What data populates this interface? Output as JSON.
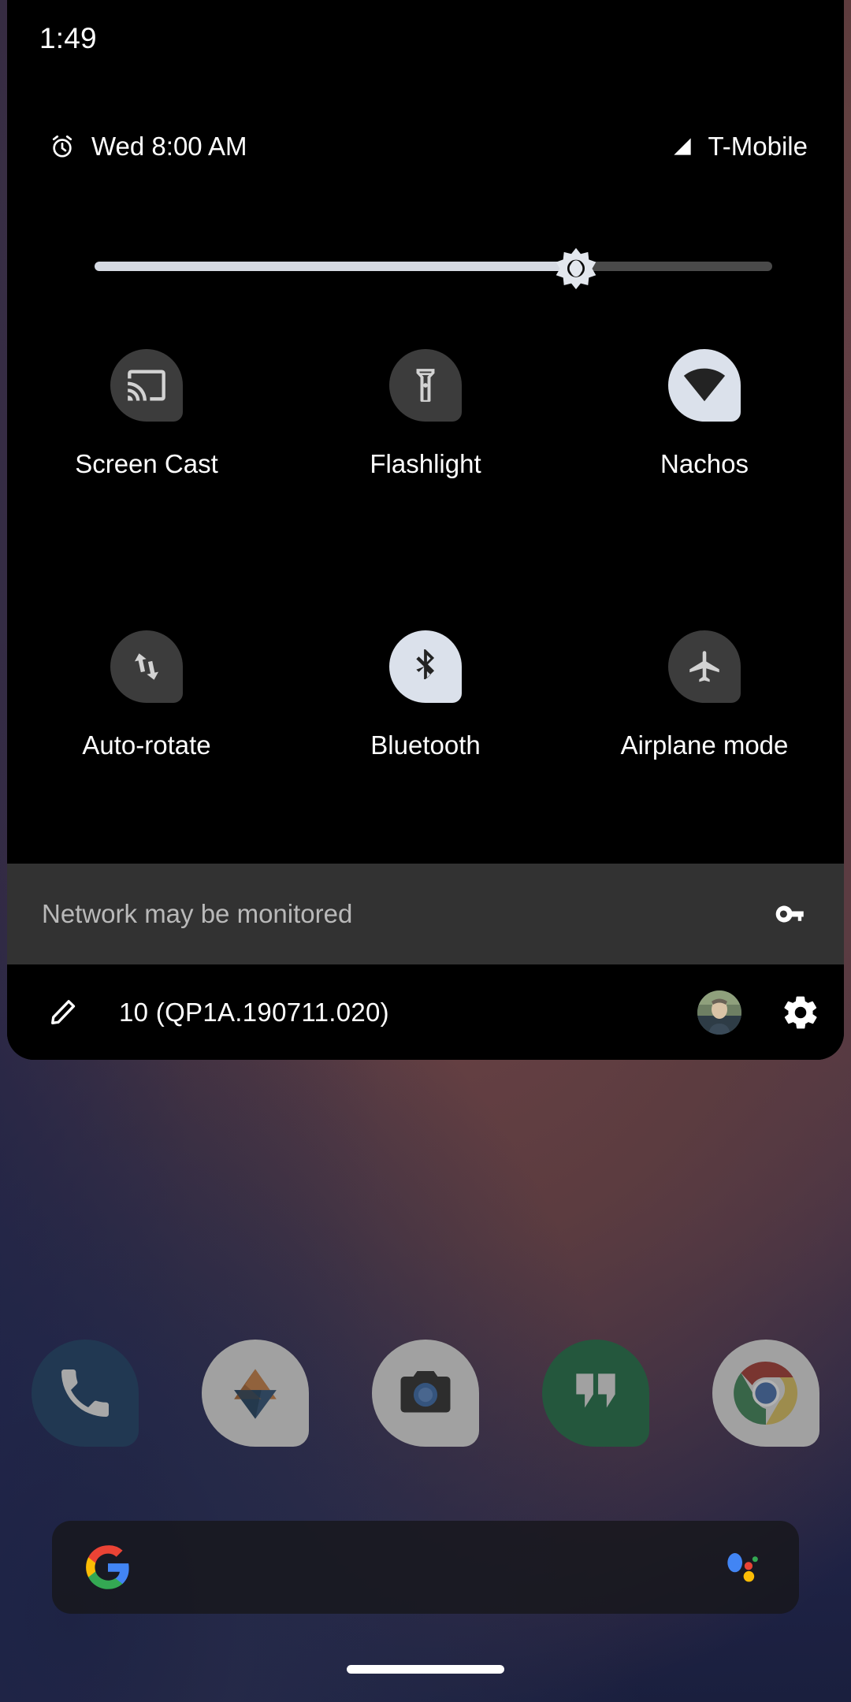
{
  "status_bar": {
    "clock": "1:49"
  },
  "qs_header": {
    "alarm_icon": "alarm-clock-icon",
    "alarm_text": "Wed 8:00 AM",
    "signal_icon": "signal-bars-icon",
    "carrier": "T-Mobile"
  },
  "brightness": {
    "name": "brightness-slider",
    "value_percent": 71,
    "thumb_icon": "brightness-sun-icon",
    "track_active_color": "#d6dae3",
    "track_inactive_color": "#4a4a4a"
  },
  "tiles": {
    "row1": [
      {
        "label": "Screen Cast",
        "icon": "cast-icon",
        "active": false
      },
      {
        "label": "Flashlight",
        "icon": "flashlight-icon",
        "active": false
      },
      {
        "label": "Nachos",
        "icon": "wifi-icon",
        "active": true
      }
    ],
    "row2": [
      {
        "label": "Auto-rotate",
        "icon": "auto-rotate-icon",
        "active": false
      },
      {
        "label": "Bluetooth",
        "icon": "bluetooth-icon",
        "active": true
      },
      {
        "label": "Airplane mode",
        "icon": "airplane-icon",
        "active": false
      }
    ],
    "active_color": "#dbe1eb",
    "inactive_color": "#3c3c3c"
  },
  "monitor_banner": {
    "text": "Network may be monitored",
    "icon": "vpn-key-icon",
    "background": "#323232"
  },
  "footer": {
    "edit_icon": "pencil-edit-icon",
    "build_label": "10 (QP1A.190711.020)",
    "avatar": "user-avatar",
    "settings_icon": "gear-icon"
  },
  "dock": [
    {
      "name": "phone",
      "icon": "phone-icon",
      "color": "#1a4a80"
    },
    {
      "name": "photos",
      "icon": "photos-triangle-icon",
      "color": "#cfcfcf"
    },
    {
      "name": "camera",
      "icon": "camera-icon",
      "color": "#cfcfcf"
    },
    {
      "name": "hangouts",
      "icon": "hangouts-icon",
      "color": "#0f7a44"
    },
    {
      "name": "chrome",
      "icon": "chrome-icon",
      "color": "#cfcfcf"
    }
  ],
  "search_bar": {
    "google_logo": "google-g-icon",
    "assistant_icon": "google-assistant-icon",
    "text": ""
  },
  "nav": {
    "pill": "home-gesture-pill"
  }
}
